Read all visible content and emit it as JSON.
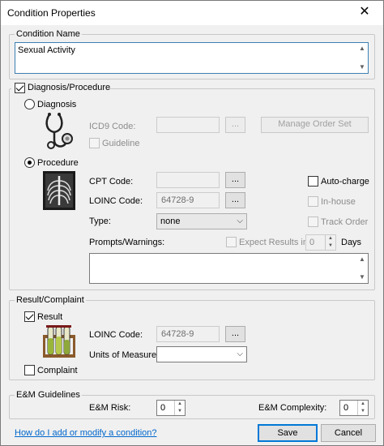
{
  "window": {
    "title": "Condition Properties",
    "close_glyph": "✕"
  },
  "condition_name": {
    "legend": "Condition Name",
    "value": "Sexual Activity"
  },
  "diagnosis_procedure": {
    "label": "Diagnosis/Procedure",
    "checked": true,
    "diagnosis": {
      "label": "Diagnosis",
      "icd9_label": "ICD9 Code:",
      "icd9_value": "",
      "browse_label": "...",
      "manage_order_set_label": "Manage Order Set",
      "guideline_label": "Guideline"
    },
    "procedure": {
      "label": "Procedure",
      "cpt_label": "CPT Code:",
      "cpt_value": "",
      "cpt_browse": "...",
      "loinc_label": "LOINC Code:",
      "loinc_value": "64728-9",
      "loinc_browse": "...",
      "type_label": "Type:",
      "type_value": "none",
      "prompts_label": "Prompts/Warnings:",
      "prompts_value": "",
      "auto_charge_label": "Auto-charge",
      "in_house_label": "In-house",
      "track_order_label": "Track Order",
      "expect_results_label": "Expect Results in:",
      "expect_results_value": "0",
      "days_label": "Days"
    }
  },
  "result_complaint": {
    "legend": "Result/Complaint",
    "result_label": "Result",
    "result_checked": true,
    "loinc_label": "LOINC Code:",
    "loinc_value": "64728-9",
    "loinc_browse": "...",
    "units_label": "Units of Measure:",
    "units_value": "",
    "complaint_label": "Complaint",
    "complaint_checked": false
  },
  "em_guidelines": {
    "legend": "E&M Guidelines",
    "risk_label": "E&M Risk:",
    "risk_value": "0",
    "complexity_label": "E&M Complexity:",
    "complexity_value": "0"
  },
  "footer": {
    "help_link": "How do I add or modify a condition?",
    "save_label": "Save",
    "cancel_label": "Cancel"
  },
  "icons": {
    "stethoscope": "stethoscope-icon",
    "xray": "xray-icon",
    "test_tubes": "test-tubes-icon"
  }
}
